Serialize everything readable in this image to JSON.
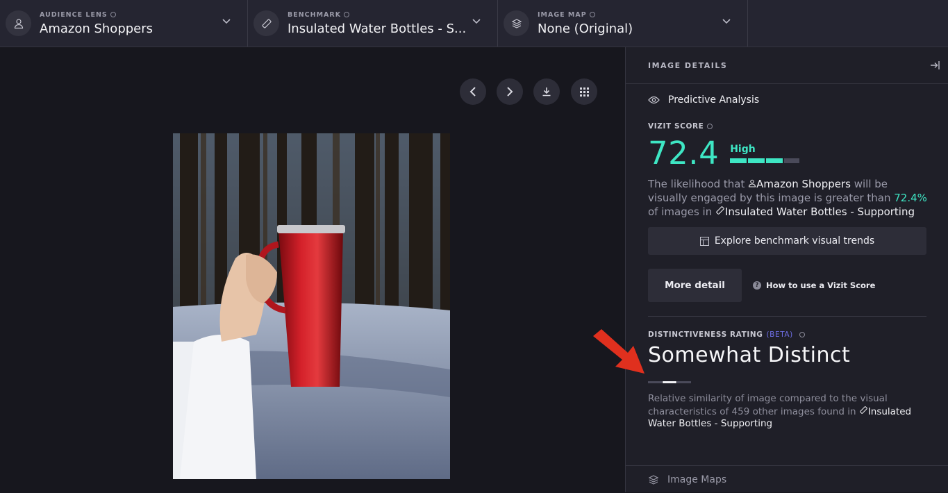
{
  "topbar": {
    "audience": {
      "label": "AUDIENCE LENS",
      "value": "Amazon Shoppers",
      "icon": "user-icon"
    },
    "benchmark": {
      "label": "BENCHMARK",
      "value": "Insulated Water Bottles - S...",
      "icon": "ruler-icon"
    },
    "image_map": {
      "label": "IMAGE MAP",
      "value": "None (Original)",
      "icon": "layers-icon"
    }
  },
  "canvas": {
    "controls": [
      "previous-icon",
      "next-icon",
      "download-icon",
      "grid-icon"
    ]
  },
  "panel": {
    "header": "IMAGE DETAILS",
    "section_title": "Predictive Analysis",
    "score_label": "VIZIT SCORE",
    "score_value": "72.4",
    "score_tier": "High",
    "score_level_percent": 72.4,
    "description": {
      "part1": "The likelihood that ",
      "audience": "Amazon Shoppers",
      "part2": " will be visually engaged by this image is greater than ",
      "percent": "72.4%",
      "part3": " of images in ",
      "benchmark": "Insulated Water Bottles - Supporting"
    },
    "explore_button": "Explore benchmark visual trends",
    "more_button": "More detail",
    "howto_link": "How to use a Vizit Score",
    "distinct_label": "DISTINCTIVENESS RATING",
    "distinct_beta": "(BETA)",
    "distinct_value": "Somewhat Distinct",
    "distinct_level": "3 of 4",
    "distinct_desc": {
      "part1": "Relative similarity of image compared to the visual characteristics of 459 other images found in ",
      "benchmark": "Insulated Water Bottles - Supporting"
    },
    "image_maps_label": "Image Maps"
  },
  "colors": {
    "accent": "#3ee6c4",
    "beta": "#6f6fe8",
    "annotation_arrow": "#e0301e",
    "panel_bg": "#1f1f28",
    "topbar_bg": "#252531"
  }
}
